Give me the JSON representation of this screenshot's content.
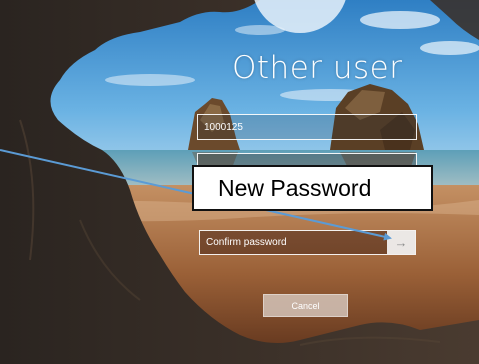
{
  "login": {
    "title": "Other user",
    "username_value": "1000125",
    "confirm_placeholder": "Confirm password",
    "submit_icon": "arrow-right-icon",
    "submit_glyph": "→",
    "cancel_label": "Cancel"
  },
  "annotation": {
    "callout_text": "New Password",
    "arrow_color": "#5b9bd5"
  },
  "colors": {
    "field_border": "#ffffff",
    "callout_border": "#111111"
  }
}
